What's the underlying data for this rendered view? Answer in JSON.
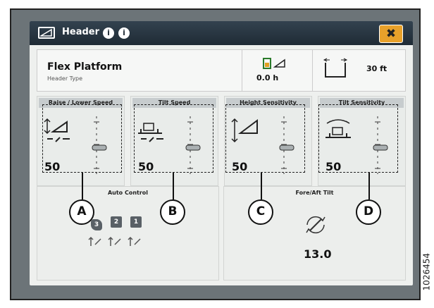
{
  "header_window": {
    "title": "Header",
    "info_a": "i",
    "info_b": "i",
    "close": "✖"
  },
  "platform": {
    "name": "Flex Platform",
    "type_label": "Header Type",
    "hours": "0.0 h",
    "width": "30 ft"
  },
  "panels": [
    {
      "title": "Raise / Lower Speed",
      "value": "50",
      "icon": "raise-lower-speed-icon"
    },
    {
      "title": "Tilt Speed",
      "value": "50",
      "icon": "tilt-speed-icon"
    },
    {
      "title": "Height Sensitivity",
      "value": "50",
      "icon": "height-sensitivity-icon"
    },
    {
      "title": "Tilt Sensitivity",
      "value": "50",
      "icon": "tilt-sensitivity-icon"
    }
  ],
  "auto_control": {
    "title": "Auto Control",
    "modes": [
      "3",
      "2",
      "1"
    ]
  },
  "fore_aft": {
    "title": "Fore/Aft Tilt",
    "value": "13.0"
  },
  "callouts": [
    "A",
    "B",
    "C",
    "D"
  ],
  "figure_number": "1026454"
}
